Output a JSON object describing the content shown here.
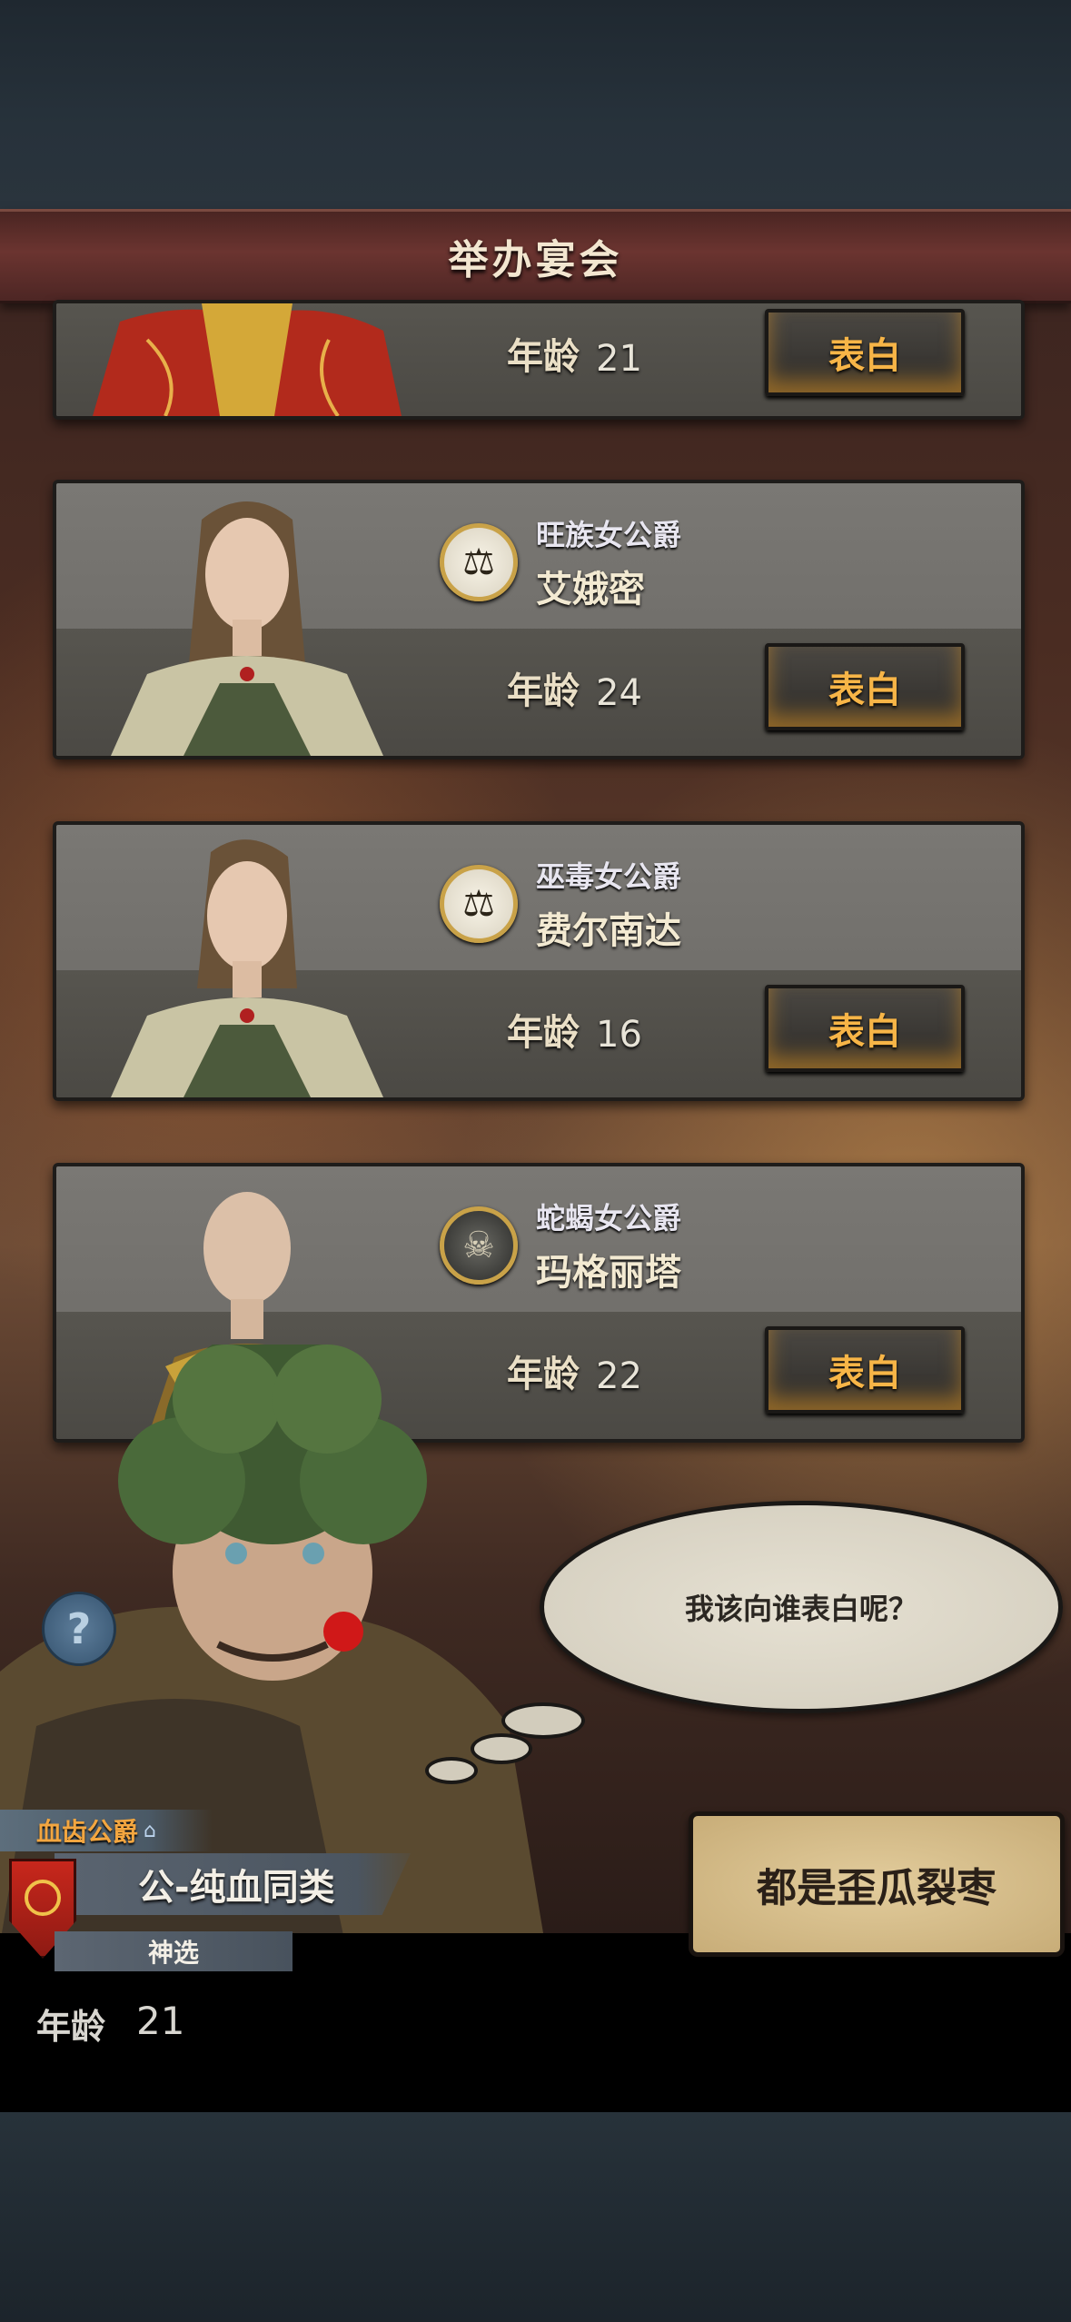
{
  "header": {
    "title": "举办宴会"
  },
  "cards": [
    {
      "title": "",
      "name": "",
      "age_label": "年龄",
      "age": "21",
      "button": "表白"
    },
    {
      "title": "旺族女公爵",
      "name": "艾娥密",
      "age_label": "年龄",
      "age": "24",
      "button": "表白",
      "emblem": "scales-icon"
    },
    {
      "title": "巫毒女公爵",
      "name": "费尔南达",
      "age_label": "年龄",
      "age": "16",
      "button": "表白",
      "emblem": "scales-icon"
    },
    {
      "title": "蛇蝎女公爵",
      "name": "玛格丽塔",
      "age_label": "年龄",
      "age": "22",
      "button": "表白",
      "emblem": "skull-icon"
    }
  ],
  "dialog": {
    "speech": "我该向谁表白呢？"
  },
  "help": {
    "icon": "question-icon",
    "label": "?"
  },
  "player": {
    "title": "血齿公爵",
    "banner": "公-纯血同类",
    "sub": "神选",
    "age_label": "年龄",
    "age": "21"
  },
  "actions": {
    "reject": "都是歪瓜裂枣"
  },
  "colors": {
    "accent": "#f7b547",
    "header": "#6b3430",
    "card": "#6a6864"
  }
}
